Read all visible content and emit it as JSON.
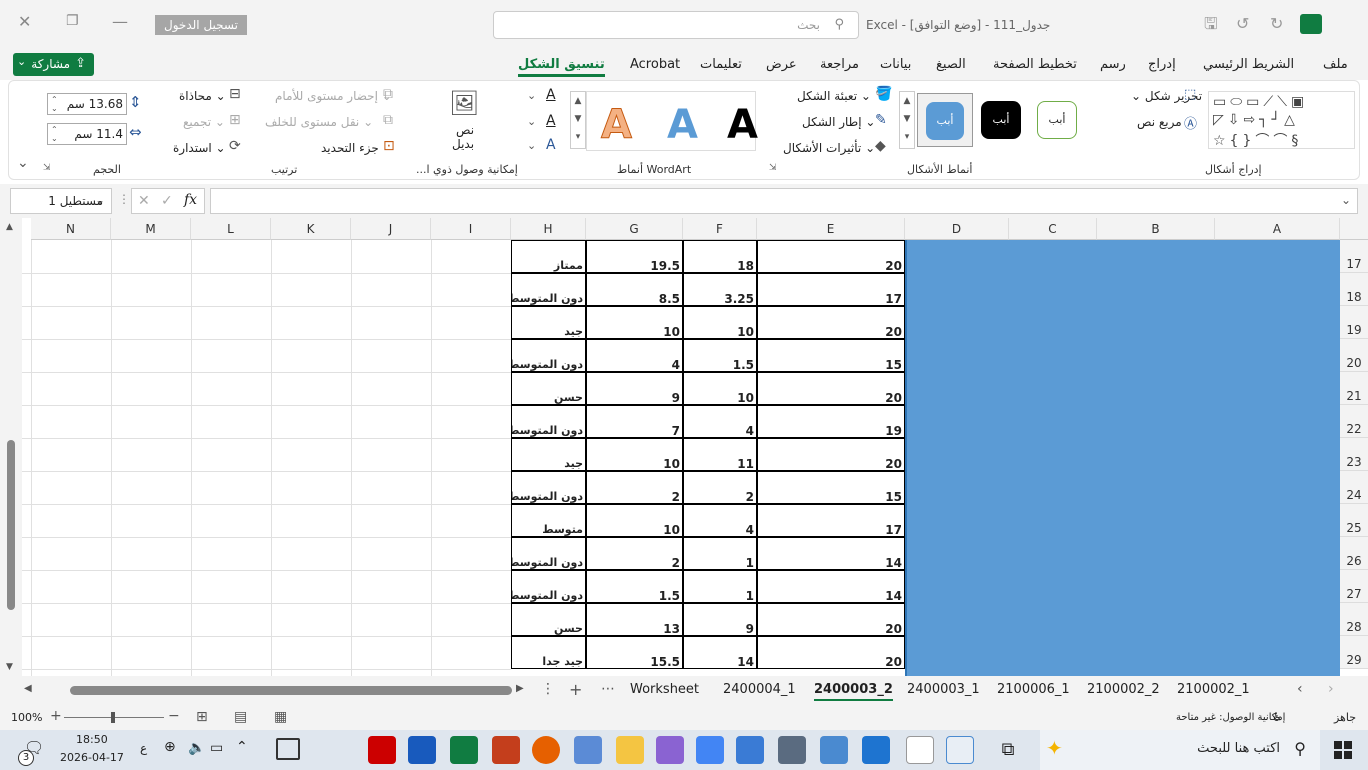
{
  "title": {
    "doc": "جدول_111  -  [وضع التوافق]  -  Excel",
    "search_placeholder": "بحث",
    "signin": "تسجيل الدخول"
  },
  "tabs": [
    "ملف",
    "الشريط الرئيسي",
    "إدراج",
    "رسم",
    "تخطيط الصفحة",
    "الصيغ",
    "بيانات",
    "مراجعة",
    "عرض",
    "تعليمات",
    "Acrobat",
    "تنسيق الشكل"
  ],
  "share": "مشاركة",
  "ribbon": {
    "insert_shapes": {
      "edit_shape": "تحرير شكل",
      "text_box": "مربع نص",
      "group": "إدراج أشكال"
    },
    "shape_styles": {
      "preset1": "أبب",
      "preset2": "أبب",
      "preset3": "أبب",
      "fill": "تعبئة الشكل",
      "outline": "إطار الشكل",
      "effects": "تأثيرات الأشكال",
      "group": "أنماط الأشكال"
    },
    "wordart": {
      "letter": "A",
      "group": "أنماط WordArt"
    },
    "accessibility": {
      "alt_text_1": "نص",
      "alt_text_2": "بديل",
      "group": "إمكانية وصول ذوي ا..."
    },
    "arrange": {
      "bring_forward": "إحضار مستوى للأمام",
      "send_backward": "نقل مستوى للخلف",
      "selection_pane": "جزء التحديد",
      "align": "محاذاة",
      "group_btn": "تجميع",
      "rotate": "استدارة",
      "group": "ترتيب"
    },
    "size": {
      "height": "13.68 سم",
      "width": "11.4 سم",
      "group": "الحجم"
    }
  },
  "namebox": "مستطيل 1",
  "fx": "fx",
  "columns": [
    "A",
    "B",
    "C",
    "D",
    "E",
    "F",
    "G",
    "H",
    "I",
    "J",
    "K",
    "L",
    "M",
    "N"
  ],
  "rows": [
    {
      "n": "17",
      "e": "20",
      "f": "18",
      "g": "19.5",
      "h": "ممتاز"
    },
    {
      "n": "18",
      "e": "17",
      "f": "3.25",
      "g": "8.5",
      "h": "دون المتوسط"
    },
    {
      "n": "19",
      "e": "20",
      "f": "10",
      "g": "10",
      "h": "جيد"
    },
    {
      "n": "20",
      "e": "15",
      "f": "1.5",
      "g": "4",
      "h": "دون المتوسط"
    },
    {
      "n": "21",
      "e": "20",
      "f": "10",
      "g": "9",
      "h": "حسن"
    },
    {
      "n": "22",
      "e": "19",
      "f": "4",
      "g": "7",
      "h": "دون المتوسط"
    },
    {
      "n": "23",
      "e": "20",
      "f": "11",
      "g": "10",
      "h": "جيد"
    },
    {
      "n": "24",
      "e": "15",
      "f": "2",
      "g": "2",
      "h": "دون المتوسط"
    },
    {
      "n": "25",
      "e": "17",
      "f": "4",
      "g": "10",
      "h": "متوسط"
    },
    {
      "n": "26",
      "e": "14",
      "f": "1",
      "g": "2",
      "h": "دون المتوسط"
    },
    {
      "n": "27",
      "e": "14",
      "f": "1",
      "g": "1.5",
      "h": "دون المتوسط"
    },
    {
      "n": "28",
      "e": "20",
      "f": "9",
      "g": "13",
      "h": "حسن"
    },
    {
      "n": "29",
      "e": "20",
      "f": "14",
      "g": "15.5",
      "h": "جيد جدا"
    }
  ],
  "sheets": [
    "Worksheet",
    "2400004_1",
    "2400003_2",
    "2400003_1",
    "2100006_1",
    "2100002_2",
    "2100002_1"
  ],
  "active_sheet": "2400003_2",
  "status": {
    "ready": "جاهز",
    "accessibility": "إمكانية الوصول: غير متاحة",
    "zoom": "100%"
  },
  "taskbar": {
    "search": "اكتب هنا للبحث",
    "time": "18:50",
    "date": "2026-04-17",
    "lang": "ع",
    "badge": "3"
  },
  "colors": {
    "excel_green": "#107c41",
    "shape_fill": "#5b9bd5"
  }
}
